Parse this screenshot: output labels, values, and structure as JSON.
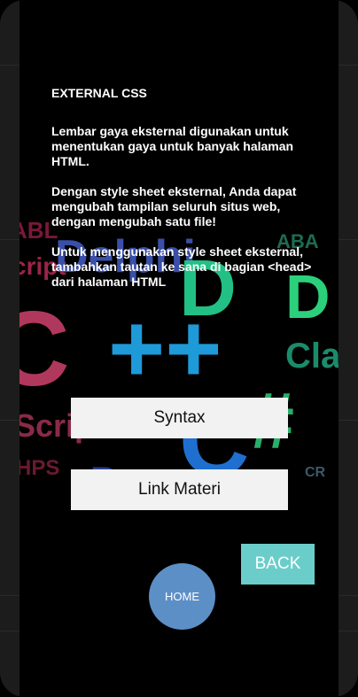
{
  "content": {
    "title": "EXTERNAL CSS",
    "paragraphs": [
      "Lembar gaya eksternal digunakan untuk menentukan gaya untuk banyak halaman HTML.",
      "Dengan style sheet eksternal, Anda dapat mengubah tampilan seluruh situs web, dengan mengubah satu file!",
      "Untuk menggunakan style sheet eksternal, tambahkan tautan ke sana di bagian <head> dari halaman HTML"
    ]
  },
  "buttons": {
    "syntax": "Syntax",
    "link_materi": "Link Materi",
    "back": "BACK",
    "home": "HOME"
  },
  "background_words": [
    "ABL",
    "cript",
    "Delphi",
    "C",
    "++",
    "D",
    "ABA",
    "D",
    "Cla",
    "Script",
    "C",
    "#",
    "HPS",
    "Ru",
    "CR"
  ],
  "colors": {
    "back_button": "#6bcdc9",
    "home_button": "#5d8fc7",
    "light_button": "#f2f2f2"
  }
}
